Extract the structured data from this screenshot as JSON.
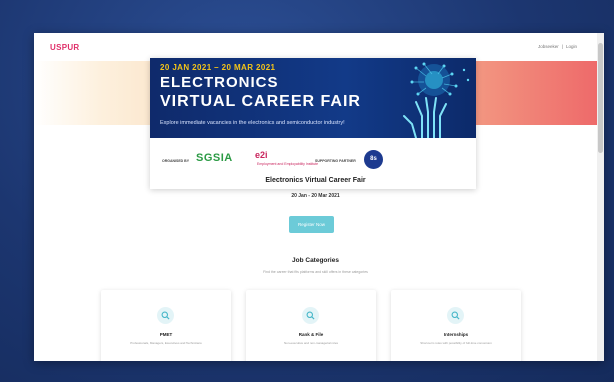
{
  "nav": {
    "logo": "USPUR",
    "login_links": [
      "Jobseeker",
      "|",
      "Login"
    ]
  },
  "banner": {
    "dates": "20 JAN 2021 – 20 MAR 2021",
    "title_line1": "ELECTRONICS",
    "title_line2": "VIRTUAL CAREER FAIR",
    "tagline": "Explore immediate vacancies in the electronics and semiconductor industry!",
    "organised_by": "ORGANISED BY",
    "org_logo_1": "SGSIA",
    "org_logo_2": "e2i",
    "org_logo_2_sub": "Employment and Employability Institute",
    "partner_label": "SUPPORTING PARTNER",
    "partner_logo": "8s"
  },
  "event": {
    "title": "Electronics Virtual Career Fair",
    "dates": "20 Jan - 20 Mar 2021",
    "register_label": "Register Now"
  },
  "categories": {
    "title": "Job Categories",
    "subtitle": "Find the career that fits platforms and skill offers in these categories",
    "items": [
      {
        "title": "PMET",
        "desc": "Professionals, Managers, Executives and Technicians"
      },
      {
        "title": "Rank & File",
        "desc": "Non-executive and non-managerial roles"
      },
      {
        "title": "Internships",
        "desc": "Short-term roles with possibility of full-time conversion"
      }
    ]
  },
  "colors": {
    "brand": "#e0306a",
    "accent": "#6ccbd8",
    "banner_bg": "#123a88",
    "banner_dates": "#f5c518"
  }
}
